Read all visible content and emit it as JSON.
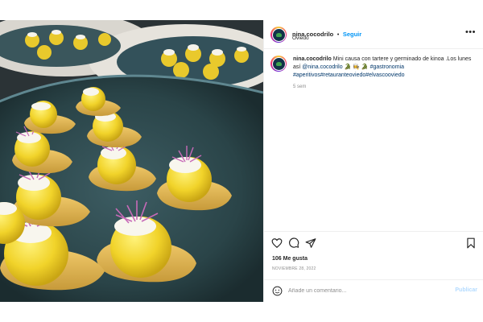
{
  "post": {
    "username": "nina.cocodrilo",
    "follow_label": "Seguir",
    "separator": "•",
    "location": "Oviedo",
    "more_label": "•••",
    "caption": {
      "username": "nina.cocodrilo",
      "text": "Mini causa con tartere y germinado de kinoa .Los lunes así",
      "mention": "@nina.cocodrilo",
      "emoji": "🐊 👩‍🍳 🐊",
      "hashtags": "#gastronomia #aperitivos#retauranteoviedo#elvascooviedo"
    },
    "time_ago": "5 sem",
    "likes": "106 Me gusta",
    "date": "NOVIEMBRE 28, 2022",
    "comment": {
      "placeholder": "Añade un comentario...",
      "value": "",
      "publish_label": "Publicar"
    }
  },
  "icons": [
    "user-avatar",
    "more-options-icon",
    "heart-icon",
    "comment-icon",
    "share-icon",
    "bookmark-icon",
    "emoji-icon"
  ],
  "colors": {
    "link": "#00376b",
    "follow": "#0095f6",
    "publish_disabled": "#b3dbff",
    "muted": "#8e8e8e"
  }
}
